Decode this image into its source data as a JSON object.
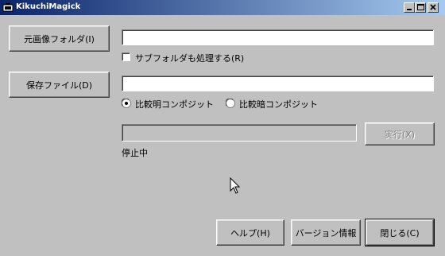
{
  "window": {
    "title": "KikuchiMagick"
  },
  "source": {
    "button_label": "元画像フォルダ(I)",
    "path_value": "",
    "subfolder_checkbox_label": "サブフォルダも処理する(R)",
    "subfolder_checked": false
  },
  "output": {
    "button_label": "保存ファイル(D)",
    "path_value": "",
    "mode_options": [
      {
        "label": "比較明コンポジット",
        "selected": true
      },
      {
        "label": "比較暗コンポジット",
        "selected": false
      }
    ]
  },
  "progress": {
    "value": 0
  },
  "run_button": {
    "label": "実行(X)",
    "enabled": false
  },
  "status": {
    "text": "停止中"
  },
  "footer": {
    "help_label": "ヘルプ(H)",
    "version_label": "バージョン情報",
    "close_label": "閉じる(C)"
  }
}
